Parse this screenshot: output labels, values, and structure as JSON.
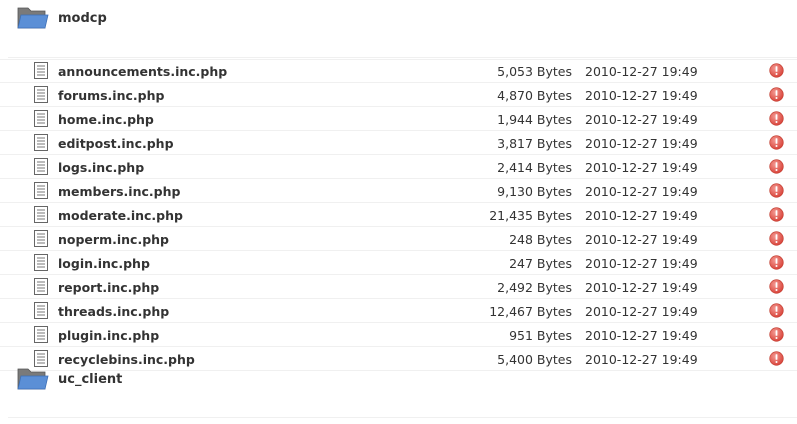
{
  "folders": [
    {
      "name": "modcp",
      "icon": "folder-icon"
    },
    {
      "name": "uc_client",
      "icon": "folder-icon"
    }
  ],
  "colors": {
    "warning": "#e2564e",
    "folder": "#5b8fd6",
    "row_border": "#f0f0f0"
  },
  "files": [
    {
      "name": "announcements.inc.php",
      "size": "5,053 Bytes",
      "date": "2010-12-27 19:49"
    },
    {
      "name": "forums.inc.php",
      "size": "4,870 Bytes",
      "date": "2010-12-27 19:49"
    },
    {
      "name": "home.inc.php",
      "size": "1,944 Bytes",
      "date": "2010-12-27 19:49"
    },
    {
      "name": "editpost.inc.php",
      "size": "3,817 Bytes",
      "date": "2010-12-27 19:49"
    },
    {
      "name": "logs.inc.php",
      "size": "2,414 Bytes",
      "date": "2010-12-27 19:49"
    },
    {
      "name": "members.inc.php",
      "size": "9,130 Bytes",
      "date": "2010-12-27 19:49"
    },
    {
      "name": "moderate.inc.php",
      "size": "21,435 Bytes",
      "date": "2010-12-27 19:49"
    },
    {
      "name": "noperm.inc.php",
      "size": "248 Bytes",
      "date": "2010-12-27 19:49"
    },
    {
      "name": "login.inc.php",
      "size": "247 Bytes",
      "date": "2010-12-27 19:49"
    },
    {
      "name": "report.inc.php",
      "size": "2,492 Bytes",
      "date": "2010-12-27 19:49"
    },
    {
      "name": "threads.inc.php",
      "size": "12,467 Bytes",
      "date": "2010-12-27 19:49"
    },
    {
      "name": "plugin.inc.php",
      "size": "951 Bytes",
      "date": "2010-12-27 19:49"
    },
    {
      "name": "recyclebins.inc.php",
      "size": "5,400 Bytes",
      "date": "2010-12-27 19:49"
    }
  ]
}
